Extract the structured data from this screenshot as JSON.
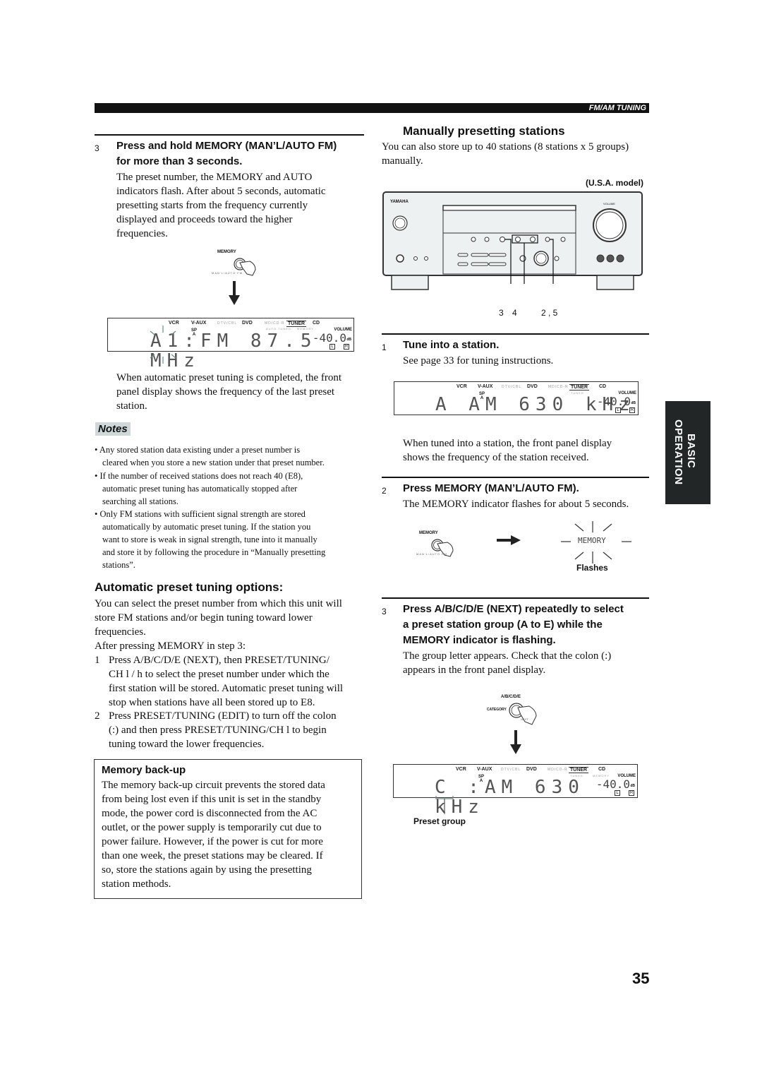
{
  "header": {
    "section_label": "FM/AM TUNING"
  },
  "side_tab": {
    "line1": "BASIC",
    "line2": "OPERATION"
  },
  "page_number": "35",
  "left": {
    "step3": {
      "number": "3",
      "heading_line1": "Press and hold MEMORY (MAN’L/AUTO FM)",
      "heading_line2": "for more than 3 seconds.",
      "body": [
        "The preset number, the MEMORY and AUTO",
        "indicators flash. After about 5 seconds, automatic",
        "presetting starts from the frequency currently",
        "displayed and proceeds toward the higher",
        "frequencies."
      ]
    },
    "memory_button": {
      "label": "MEMORY",
      "sublabel": "MAN’L/AUTO FM"
    },
    "display1": {
      "sources": [
        "VCR",
        "V-AUX",
        "DTV/CBL",
        "DVD",
        "MD/CD-R",
        "TUNER",
        "CD"
      ],
      "sp": "SP",
      "sp_sub": "A",
      "indicator_auto": "AUTO TUNED",
      "indicator_memory": "MEMORY",
      "main_text": "A1:FM 87.5 MHz",
      "volume_label": "VOLUME",
      "volume_value": "-40.0",
      "volume_unit": "dB",
      "left_ch": "L",
      "right_ch": "R"
    },
    "after_display": [
      "When automatic preset tuning is completed, the front",
      "panel display shows the frequency of the last preset",
      "station."
    ],
    "notes": {
      "label": "Notes",
      "items": [
        [
          "Any stored station data existing under a preset number is",
          "cleared when you store a new station under that preset number."
        ],
        [
          "If the number of received stations does not reach 40 (E8),",
          "automatic preset tuning has automatically stopped after",
          "searching all stations."
        ],
        [
          "Only FM stations with sufficient signal strength are stored",
          "automatically by automatic preset tuning. If the station you",
          "want to store is weak in signal strength, tune into it manually",
          "and store it by following the procedure in “Manually presetting",
          "stations”."
        ]
      ]
    },
    "auto_options": {
      "title": "Automatic preset tuning options:",
      "intro": [
        "You can select the preset number from which this unit will",
        "store FM stations and/or begin tuning toward lower",
        "frequencies.",
        "After pressing MEMORY in step 3:"
      ],
      "steps": [
        {
          "num": "1",
          "lines": [
            "Press A/B/C/D/E (NEXT), then PRESET/TUNING/",
            "CH l   / h   to select the preset number under which the",
            "first station will be stored. Automatic preset tuning will",
            "stop when stations have all been stored up to E8."
          ]
        },
        {
          "num": "2",
          "lines": [
            "Press PRESET/TUNING (EDIT) to turn off the colon",
            "(:) and then press PRESET/TUNING/CH l    to begin",
            "tuning toward the lower frequencies."
          ]
        }
      ]
    },
    "memory_backup": {
      "title": "Memory back-up",
      "lines": [
        "The memory back-up circuit prevents the stored data",
        "from being lost even if this unit is set in the standby",
        "mode, the power cord is disconnected from the AC",
        "outlet, or the power supply is temporarily cut due to",
        "power failure. However, if the power is cut for more",
        "than one week, the preset stations may be cleared. If",
        "so, store the stations again by using the presetting",
        "station methods."
      ]
    }
  },
  "right": {
    "title": "Manually presetting stations",
    "intro": [
      "You can also store up to 40 stations (8 stations x 5 groups)",
      "manually."
    ],
    "model_label": "(U.S.A. model)",
    "receiver": {
      "brand": "YAMAHA",
      "volume_label": "VOLUME",
      "callouts": [
        "3",
        "4",
        "2 , 5"
      ]
    },
    "step1": {
      "number": "1",
      "heading": "Tune into a station.",
      "body": "See page 33 for tuning instructions."
    },
    "display2": {
      "sources": [
        "VCR",
        "V-AUX",
        "DTV/CBL",
        "DVD",
        "MD/CD-R",
        "TUNER",
        "CD"
      ],
      "sp": "SP",
      "sp_sub": "A",
      "tuned": "TUNED",
      "main_text": "A  AM  630 kHz",
      "volume_label": "VOLUME",
      "volume_value": "-40.0",
      "volume_unit": "dB",
      "left_ch": "L",
      "right_ch": "R"
    },
    "after_display2": [
      "When tuned into a station, the front panel display",
      "shows the frequency of the station received."
    ],
    "step2": {
      "number": "2",
      "heading": "Press MEMORY (MAN’L/AUTO FM).",
      "body": "The MEMORY indicator flashes for about 5 seconds."
    },
    "memory_flash": {
      "button_label": "MEMORY",
      "button_sublabel": "MAN’L/AUTO FM",
      "indicator": "MEMORY",
      "caption": "Flashes"
    },
    "step3": {
      "number": "3",
      "heading_lines": [
        "Press A/B/C/D/E (NEXT) repeatedly to select",
        "a preset station group (A to E) while the",
        "MEMORY indicator is flashing."
      ],
      "body": [
        "The group letter appears. Check that the colon (:)",
        "appears in the front panel display."
      ]
    },
    "category_button": {
      "label": "A/B/C/D/E",
      "left_label": "CATEGORY",
      "sublabel": "NEXT"
    },
    "display3": {
      "sources": [
        "VCR",
        "V-AUX",
        "DTV/CBL",
        "DVD",
        "MD/CD-R",
        "TUNER",
        "CD"
      ],
      "sp": "SP",
      "sp_sub": "A",
      "tuned": "TUNED",
      "indicator_memory": "MEMORY",
      "main_text": "C :AM  630 kHz",
      "volume_label": "VOLUME",
      "volume_value": "-40.0",
      "volume_unit": "dB",
      "left_ch": "L",
      "right_ch": "R"
    },
    "preset_group_caption": "Preset group"
  }
}
